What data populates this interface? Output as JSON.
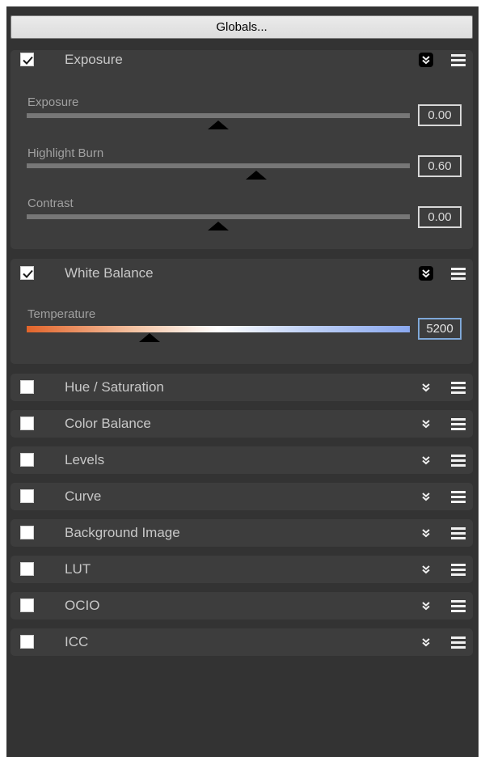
{
  "globals_button": "Globals...",
  "sections": [
    {
      "title": "Exposure",
      "enabled": true,
      "expanded": true,
      "sliders": [
        {
          "label": "Exposure",
          "value": "0.00",
          "position": 0.5
        },
        {
          "label": "Highlight Burn",
          "value": "0.60",
          "position": 0.6
        },
        {
          "label": "Contrast",
          "value": "0.00",
          "position": 0.5
        }
      ]
    },
    {
      "title": "White Balance",
      "enabled": true,
      "expanded": true,
      "sliders": [
        {
          "label": "Temperature",
          "value": "5200",
          "position": 0.32
        }
      ]
    },
    {
      "title": "Hue / Saturation",
      "enabled": false,
      "expanded": false
    },
    {
      "title": "Color Balance",
      "enabled": false,
      "expanded": false
    },
    {
      "title": "Levels",
      "enabled": false,
      "expanded": false
    },
    {
      "title": "Curve",
      "enabled": false,
      "expanded": false
    },
    {
      "title": "Background Image",
      "enabled": false,
      "expanded": false
    },
    {
      "title": "LUT",
      "enabled": false,
      "expanded": false
    },
    {
      "title": "OCIO",
      "enabled": false,
      "expanded": false
    },
    {
      "title": "ICC",
      "enabled": false,
      "expanded": false
    }
  ],
  "icons": {
    "checkbox": "checkmark-icon",
    "collapse": "double-chevron-down-icon",
    "menu": "hamburger-menu-icon"
  },
  "colors": {
    "panel_bg": "#333333",
    "section_bg": "#3d3d3d",
    "slider_track": "#777777",
    "temp_warm": "#e2642a",
    "temp_cool": "#8aa8ef"
  }
}
